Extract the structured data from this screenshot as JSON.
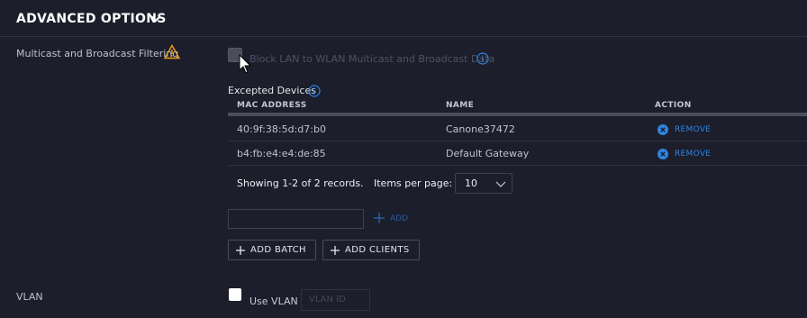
{
  "section": {
    "title": "ADVANCED OPTIONS"
  },
  "multicast": {
    "label": "Multicast and Broadcast Filtering",
    "checkbox_label": "Block LAN to WLAN Multicast and Broadcast Data",
    "checked": false,
    "disabled": true
  },
  "excepted": {
    "label": "Excepted Devices",
    "columns": [
      "MAC ADDRESS",
      "NAME",
      "ACTION"
    ],
    "rows": [
      {
        "mac": "40:9f:38:5d:d7:b0",
        "name": "Canone37472",
        "action": "REMOVE"
      },
      {
        "mac": "b4:fb:e4:e4:de:85",
        "name": "Default Gateway",
        "action": "REMOVE"
      }
    ],
    "pager_text": "Showing 1-2 of 2 records.",
    "items_per_page_label": "Items per page:",
    "items_per_page_value": "10",
    "mac_input_value": "",
    "add_label": "ADD",
    "add_batch_label": "ADD BATCH",
    "add_clients_label": "ADD CLIENTS"
  },
  "vlan": {
    "label": "VLAN",
    "checkbox_label": "Use VLAN",
    "checked": false,
    "input_placeholder": "VLAN ID"
  },
  "colors": {
    "background": "#1c1e2b",
    "accent": "#2f84e0",
    "warning": "#f0a020",
    "text": "#c8cad3"
  },
  "icons": [
    "chevron-down-icon",
    "warning-icon",
    "info-icon",
    "mouse-cursor-icon",
    "remove-x-icon",
    "plus-icon"
  ]
}
